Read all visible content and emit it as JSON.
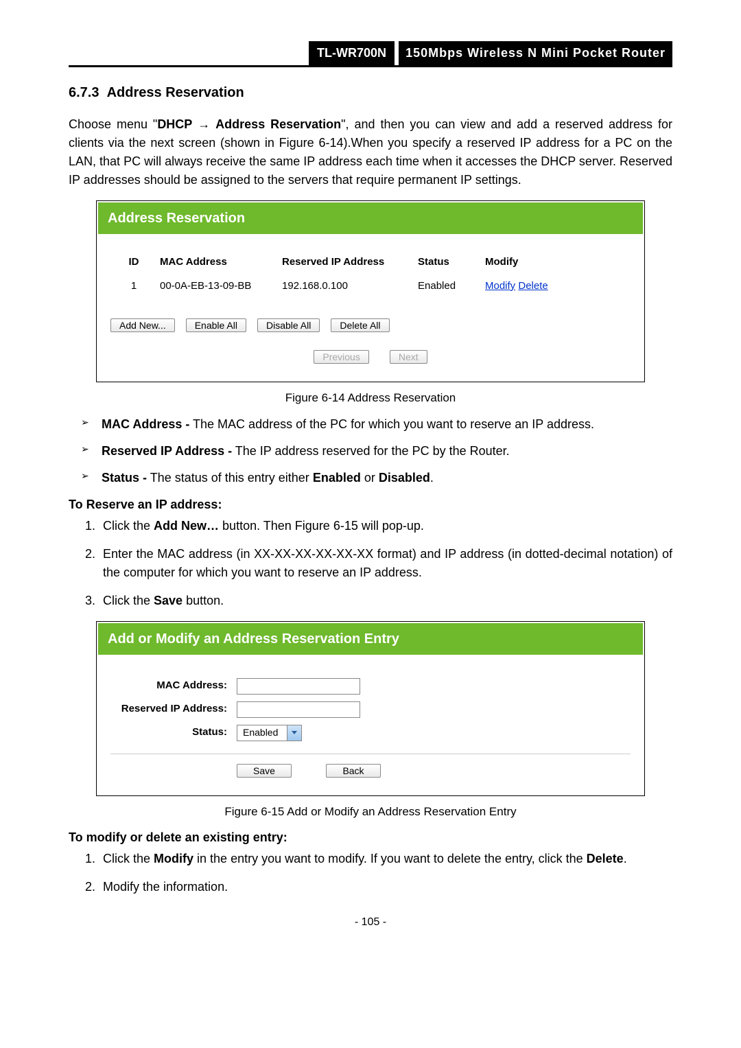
{
  "header": {
    "model": "TL-WR700N",
    "desc": "150Mbps Wireless N Mini Pocket Router"
  },
  "section_number": "6.7.3",
  "section_title": "Address Reservation",
  "intro_parts": {
    "pre": "Choose menu \"",
    "menu1": "DHCP",
    "arrow": "→",
    "menu2": "Address Reservation",
    "post": "\", and then you can view and add a reserved address for clients via the next screen (shown in Figure 6-14).When you specify a reserved IP address for a PC on the LAN, that PC will always receive the same IP address each time when it accesses the DHCP server. Reserved IP addresses should be assigned to the servers that require permanent IP settings."
  },
  "panel1": {
    "title": "Address Reservation",
    "headers": {
      "id": "ID",
      "mac": "MAC Address",
      "ip": "Reserved IP Address",
      "status": "Status",
      "modify": "Modify"
    },
    "row": {
      "id": "1",
      "mac": "00-0A-EB-13-09-BB",
      "ip": "192.168.0.100",
      "status": "Enabled",
      "modify": "Modify",
      "delete": "Delete"
    },
    "buttons": {
      "add": "Add New...",
      "enable": "Enable All",
      "disable": "Disable All",
      "delete": "Delete All",
      "prev": "Previous",
      "next": "Next"
    }
  },
  "fig1_caption": "Figure 6-14    Address Reservation",
  "defs": {
    "mac_b": "MAC Address -",
    "mac_t": " The MAC address of the PC for which you want to reserve an IP address.",
    "ip_b": "Reserved IP Address -",
    "ip_t": " The IP address reserved for the PC by the Router.",
    "st_b": "Status -",
    "st_t1": " The status of this entry either ",
    "st_en": "Enabled",
    "st_or": " or ",
    "st_dis": "Disabled",
    "st_dot": "."
  },
  "reserve_heading": "To Reserve an IP address:",
  "steps1": {
    "s1a": "Click the ",
    "s1b": "Add New…",
    "s1c": " button. Then Figure 6-15 will pop-up.",
    "s2": "Enter the MAC address (in XX-XX-XX-XX-XX-XX format) and IP address (in dotted-decimal notation) of the computer for which you want to reserve an IP address.",
    "s3a": "Click the ",
    "s3b": "Save",
    "s3c": " button."
  },
  "panel2": {
    "title": "Add or Modify an Address Reservation Entry",
    "labels": {
      "mac": "MAC Address:",
      "ip": "Reserved IP Address:",
      "status": "Status:"
    },
    "status_value": "Enabled",
    "buttons": {
      "save": "Save",
      "back": "Back"
    }
  },
  "fig2_caption": "Figure 6-15    Add or Modify an Address Reservation Entry",
  "modify_heading": "To modify or delete an existing entry:",
  "steps2": {
    "s1a": "Click the ",
    "s1b": "Modify",
    "s1c": " in the entry you want to modify. If you want to delete the entry, click the ",
    "s1d": "Delete",
    "s1e": ".",
    "s2": "Modify the information."
  },
  "page_num": "- 105 -"
}
